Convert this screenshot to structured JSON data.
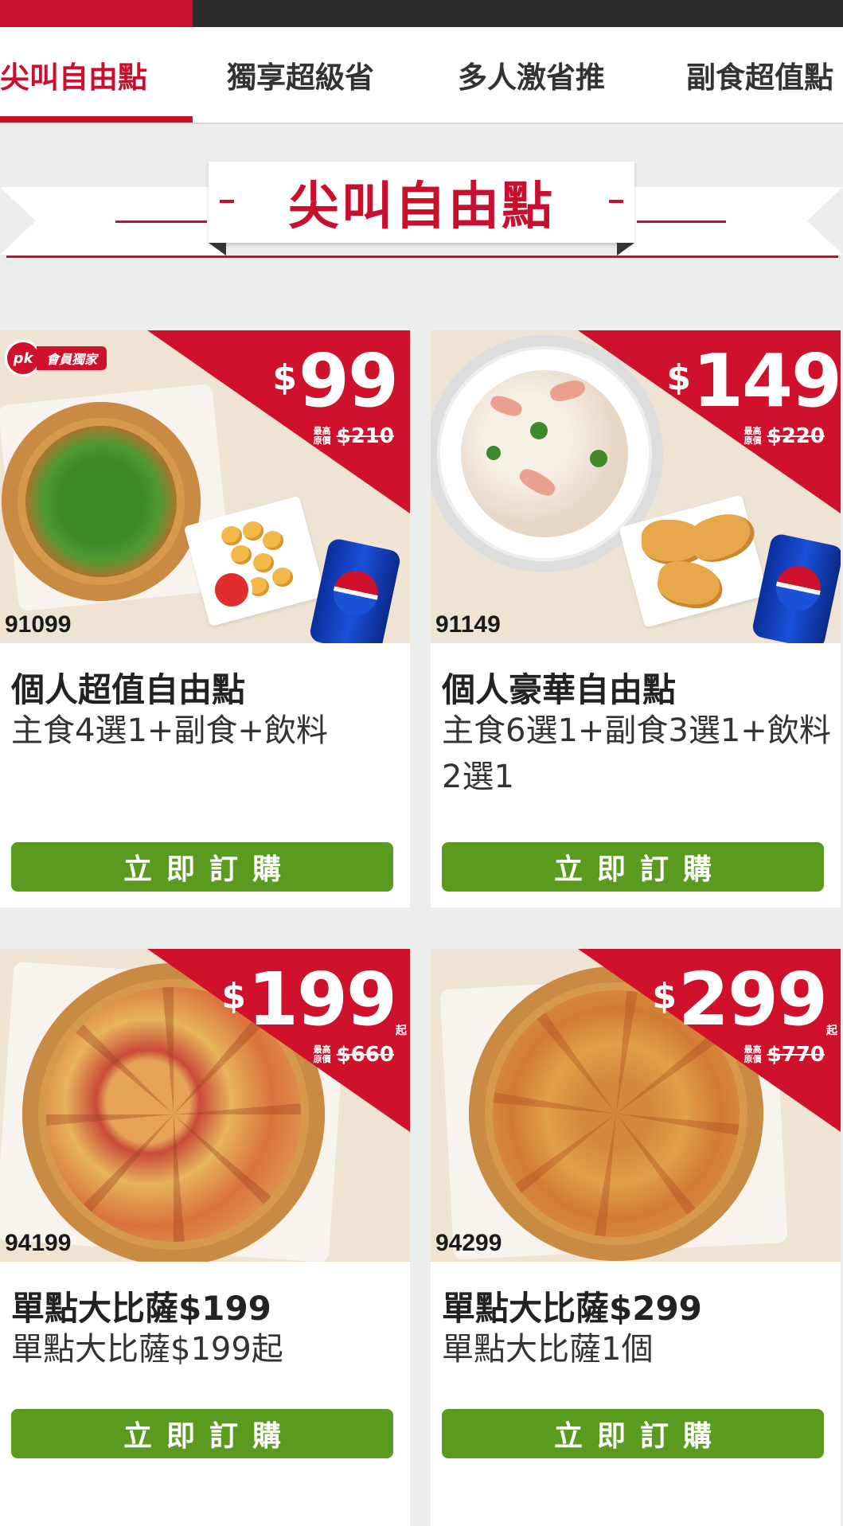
{
  "tabs": [
    {
      "label": "尖叫自由點",
      "active": true
    },
    {
      "label": "獨享超級省",
      "active": false
    },
    {
      "label": "多人激省推",
      "active": false
    },
    {
      "label": "副食超值點",
      "active": false
    }
  ],
  "section_title": "尖叫自由點",
  "member_badge": {
    "logo": "pk",
    "label": "會員獨家"
  },
  "currency_symbol": "$",
  "orig_price_prefix": "最高原價",
  "products": [
    {
      "code": "91099",
      "price": "99",
      "price_suffix": "",
      "original_price": "$210",
      "title": "個人超值自由點",
      "description": "主食4選1+副食+飲料",
      "button": "立即訂購",
      "image": "cilantro-pizza-nuggets-pepsi"
    },
    {
      "code": "91149",
      "price": "149",
      "price_suffix": "",
      "original_price": "$220",
      "title": "個人豪華自由點",
      "description": "主食6選1+副食3選1+飲料2選1",
      "button": "立即訂購",
      "image": "cream-risotto-fish-nuggets-pepsi"
    },
    {
      "code": "94199",
      "price": "199",
      "price_suffix": "起",
      "original_price": "$660",
      "title": "單點大比薩$199",
      "description": "單點大比薩$199起",
      "button": "立即訂購",
      "image": "hawaiian-large-pizza"
    },
    {
      "code": "94299",
      "price": "299",
      "price_suffix": "起",
      "original_price": "$770",
      "title": "單點大比薩$299",
      "description": "單點大比薩1個",
      "button": "立即訂購",
      "image": "spicy-sauce-large-pizza"
    }
  ],
  "colors": {
    "brand_red": "#c8102e",
    "button_green": "#5a9a1f",
    "tab_text": "#333333"
  }
}
